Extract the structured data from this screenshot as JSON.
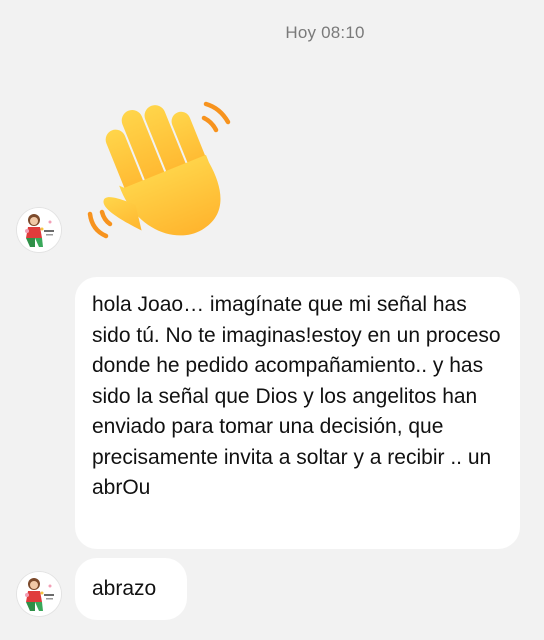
{
  "conversation": {
    "timestamp": "Hoy 08:10",
    "messages": [
      {
        "type": "emoji",
        "emoji": "waving-hand",
        "sender": "contact"
      },
      {
        "type": "text",
        "sender": "contact",
        "text": "hola Joao… imagínate que mi señal has sido tú. No te imaginas!estoy en un proceso donde he pedido acompañamiento.. y has sido la señal que Dios y los angelitos han enviado para tomar una decisión, que precisamente invita a soltar y a recibir .. un abrOu"
      },
      {
        "type": "text",
        "sender": "contact",
        "text": "abrazo"
      }
    ]
  },
  "colors": {
    "background": "#f2f2f2",
    "bubble": "#ffffff",
    "text": "#111111",
    "timestamp": "#7a7a7a",
    "emoji_primary": "#ffc83d",
    "emoji_motion_lines": "#f7931e"
  }
}
